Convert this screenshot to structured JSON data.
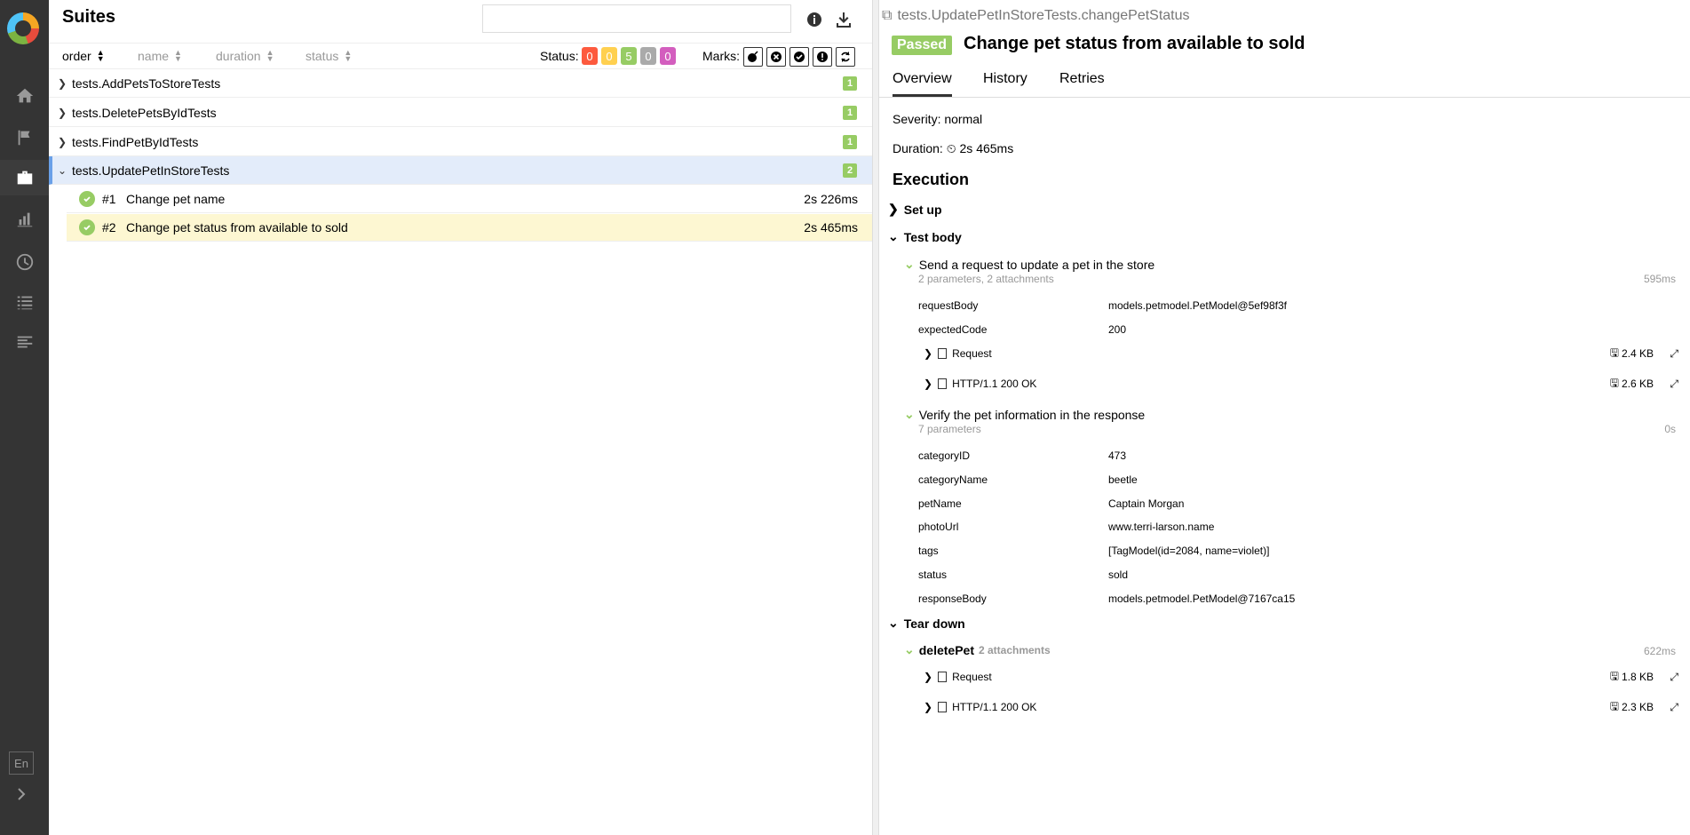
{
  "sidebar": {
    "language": "En",
    "items": [
      {
        "icon": "home-icon"
      },
      {
        "icon": "flag-icon"
      },
      {
        "icon": "briefcase-icon"
      },
      {
        "icon": "bar-chart-icon"
      },
      {
        "icon": "clock-icon"
      },
      {
        "icon": "list-icon"
      },
      {
        "icon": "align-left-icon"
      }
    ]
  },
  "left": {
    "title": "Suites",
    "search_placeholder": "",
    "sort": {
      "order": "order",
      "name": "name",
      "duration": "duration",
      "status": "status"
    },
    "status_label": "Status:",
    "status_counts": [
      {
        "value": "0",
        "color": "#fd5a3e"
      },
      {
        "value": "0",
        "color": "#ffd050"
      },
      {
        "value": "5",
        "color": "#97cc64"
      },
      {
        "value": "0",
        "color": "#aaaaaa"
      },
      {
        "value": "0",
        "color": "#d35ebe"
      }
    ],
    "marks_label": "Marks:",
    "suites": [
      {
        "name": "tests.AddPetsToStoreTests",
        "count": "1",
        "expanded": false
      },
      {
        "name": "tests.DeletePetsByIdTests",
        "count": "1",
        "expanded": false
      },
      {
        "name": "tests.FindPetByIdTests",
        "count": "1",
        "expanded": false
      },
      {
        "name": "tests.UpdatePetInStoreTests",
        "count": "2",
        "expanded": true
      }
    ],
    "cases": [
      {
        "num": "#1",
        "name": "Change pet name",
        "duration": "2s 226ms"
      },
      {
        "num": "#2",
        "name": "Change pet status from available to sold",
        "duration": "2s 465ms"
      }
    ]
  },
  "right": {
    "fullname": "tests.UpdatePetInStoreTests.changePetStatus",
    "status": "Passed",
    "title": "Change pet status from available to sold",
    "tabs": [
      "Overview",
      "History",
      "Retries"
    ],
    "severity": "Severity: normal",
    "duration_label": "Duration:",
    "duration": "2s 465ms",
    "execution": "Execution",
    "setup": "Set up",
    "test_body": "Test body",
    "tear_down": "Tear down",
    "step1": {
      "name": "Send a request to update a pet in the store",
      "sub": "2 parameters, 2 attachments",
      "duration": "595ms",
      "params": [
        {
          "k": "requestBody",
          "v": "models.petmodel.PetModel@5ef98f3f"
        },
        {
          "k": "expectedCode",
          "v": "200"
        }
      ],
      "attachments": [
        {
          "name": "Request",
          "size": "2.4 KB"
        },
        {
          "name": "HTTP/1.1 200 OK",
          "size": "2.6 KB"
        }
      ]
    },
    "step2": {
      "name": "Verify the pet information in the response",
      "sub": "7 parameters",
      "duration": "0s",
      "params": [
        {
          "k": "categoryID",
          "v": "473"
        },
        {
          "k": "categoryName",
          "v": "beetle"
        },
        {
          "k": "petName",
          "v": "Captain Morgan"
        },
        {
          "k": "photoUrl",
          "v": "www.terri-larson.name"
        },
        {
          "k": "tags",
          "v": "[TagModel(id=2084, name=violet)]"
        },
        {
          "k": "status",
          "v": "sold"
        },
        {
          "k": "responseBody",
          "v": "models.petmodel.PetModel@7167ca15"
        }
      ]
    },
    "teardown_step": {
      "name": "deletePet",
      "sub": "2 attachments",
      "duration": "622ms",
      "attachments": [
        {
          "name": "Request",
          "size": "1.8 KB"
        },
        {
          "name": "HTTP/1.1 200 OK",
          "size": "2.3 KB"
        }
      ]
    }
  }
}
